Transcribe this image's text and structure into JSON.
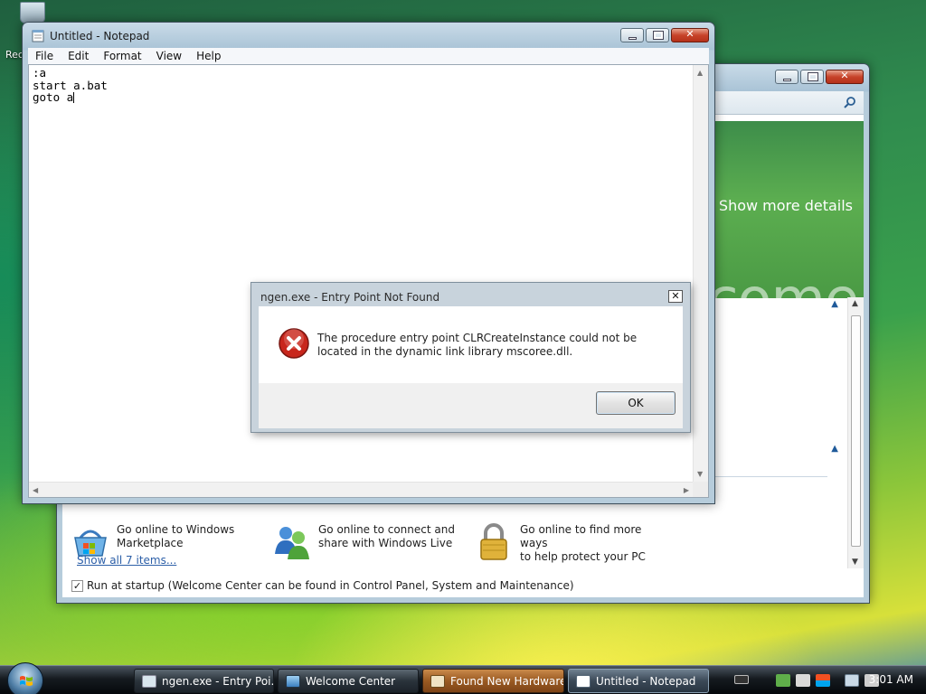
{
  "desktop": {
    "recycle_label": "Rec"
  },
  "welcome": {
    "banner_details": "Show more details",
    "banner_wordmark": "come",
    "tasks": [
      {
        "line1": "Go online to Windows",
        "line2": "Marketplace",
        "icon": "shopping-basket-icon"
      },
      {
        "line1": "Go online to connect and",
        "line2": "share with Windows Live",
        "icon": "windows-live-people-icon"
      },
      {
        "line1": "Go online to find more ways",
        "line2": "to help protect your PC",
        "icon": "padlock-icon"
      }
    ],
    "show_all": "Show all 7 items...",
    "startup_label": "Run at startup (Welcome Center can be found in Control Panel, System and Maintenance)",
    "startup_checked": true
  },
  "notepad": {
    "title": "Untitled - Notepad",
    "menu": [
      "File",
      "Edit",
      "Format",
      "View",
      "Help"
    ],
    "lines": [
      ":a",
      "start a.bat",
      "goto a"
    ]
  },
  "dialog": {
    "title": "ngen.exe - Entry Point Not Found",
    "message": "The procedure entry point CLRCreateInstance could not be located in the dynamic link library mscoree.dll.",
    "ok_label": "OK"
  },
  "taskbar": {
    "buttons": [
      {
        "label": "ngen.exe - Entry Poi...",
        "icon": "app-window-icon"
      },
      {
        "label": "Welcome Center",
        "icon": "welcome-center-icon"
      },
      {
        "label": "Found New Hardware",
        "icon": "hardware-icon"
      },
      {
        "label": "Untitled - Notepad",
        "icon": "notepad-icon"
      }
    ],
    "clock": "3:01 AM"
  },
  "colors": {
    "accent_close": "#c7432a",
    "error_red": "#c8261c",
    "link_blue": "#2c5fa8",
    "banner_green": "#4f9f48"
  }
}
